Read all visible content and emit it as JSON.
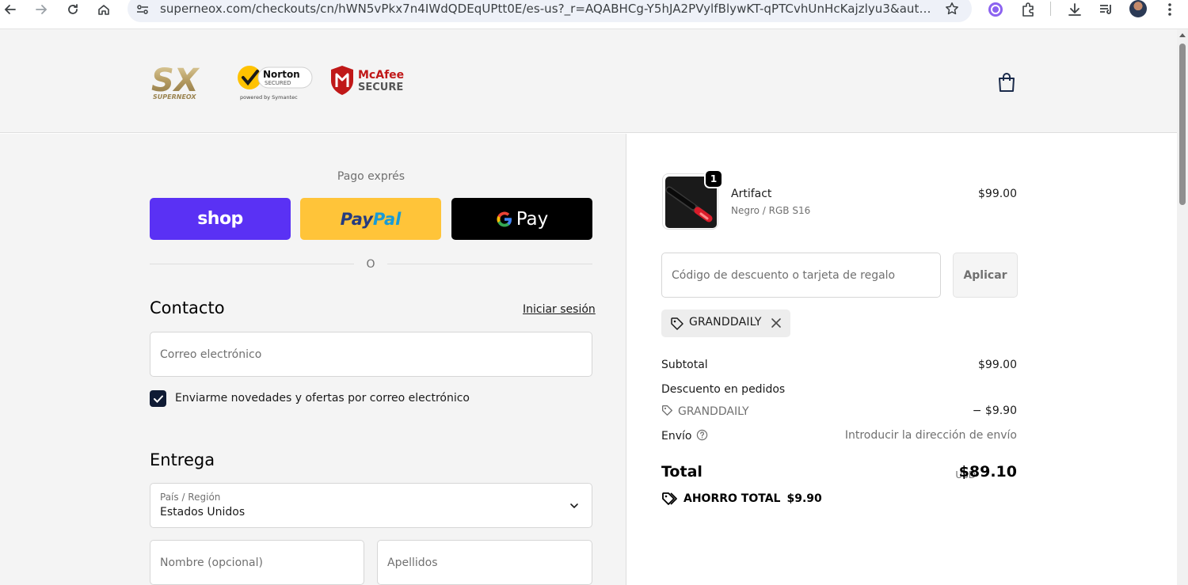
{
  "browser": {
    "url": "superneox.com/checkouts/cn/hWN5vPkx7n4IWdQDEqUPtt0E/es-us?_r=AQABHCg-Y5hJA2PVylfBlywKT-qPTCvhUnHcKajzlyu3&auto_redirect..."
  },
  "header": {
    "brand_text": "SX",
    "brand_subtext": "SUPERNEOX",
    "norton_text": "Norton",
    "norton_secured": "SECURED",
    "norton_powered": "powered by Symantec",
    "mcafee_text": "McAfee",
    "mcafee_secure": "SECURE"
  },
  "express": {
    "title": "Pago exprés",
    "shop_label": "shop",
    "paypal_label_1": "Pay",
    "paypal_label_2": "Pal",
    "gpay_label": "Pay",
    "divider_text": "O"
  },
  "contact": {
    "heading": "Contacto",
    "login_link": "Iniciar sesión",
    "email_placeholder": "Correo electrónico",
    "newsletter_label": "Enviarme novedades y ofertas por correo electrónico",
    "newsletter_checked": true
  },
  "delivery": {
    "heading": "Entrega",
    "country_label": "País / Región",
    "country_value": "Estados Unidos",
    "first_name_placeholder": "Nombre (opcional)",
    "last_name_placeholder": "Apellidos"
  },
  "summary": {
    "product": {
      "quantity": "1",
      "name": "Artifact",
      "variant": "Negro / RGB S16",
      "price": "$99.00"
    },
    "discount_placeholder": "Código de descuento o tarjeta de regalo",
    "apply_label": "Aplicar",
    "applied_code": "GRANDDAILY",
    "subtotal_label": "Subtotal",
    "subtotal_value": "$99.00",
    "order_discount_label": "Descuento en pedidos",
    "discount_code": "GRANDDAILY",
    "discount_value": "− $9.90",
    "shipping_label": "Envío",
    "shipping_value": "Introducir la dirección de envío",
    "total_label": "Total",
    "total_currency": "USD",
    "total_value": "$89.10",
    "savings_label": "AHORRO TOTAL",
    "savings_value": "$9.90"
  },
  "colors": {
    "shop_purple": "#5a31f4",
    "paypal_yellow": "#ffc439",
    "gpay_black": "#000000",
    "checkbox_navy": "#0f1b34"
  }
}
